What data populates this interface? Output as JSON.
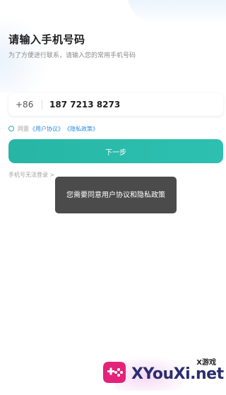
{
  "header": {
    "title": "请输入手机号码",
    "subtitle": "为了方便进行联系，请输入您的常用手机号码"
  },
  "phone": {
    "country_code": "+86",
    "value": "187 7213 8273"
  },
  "agreement": {
    "prefix": "同意",
    "user_agreement": "《用户协议》",
    "privacy_policy": "《隐私政策》"
  },
  "next_button": "下一步",
  "cant_login": "手机号无法登录 >",
  "toast": "您需要同意用户协议和隐私政策",
  "watermark": {
    "small": "X游戏",
    "big": "XYouXi.net"
  },
  "colors": {
    "accent": "#2cbcab",
    "link": "#2a8ee0",
    "toast_bg": "#4b4b4b"
  }
}
